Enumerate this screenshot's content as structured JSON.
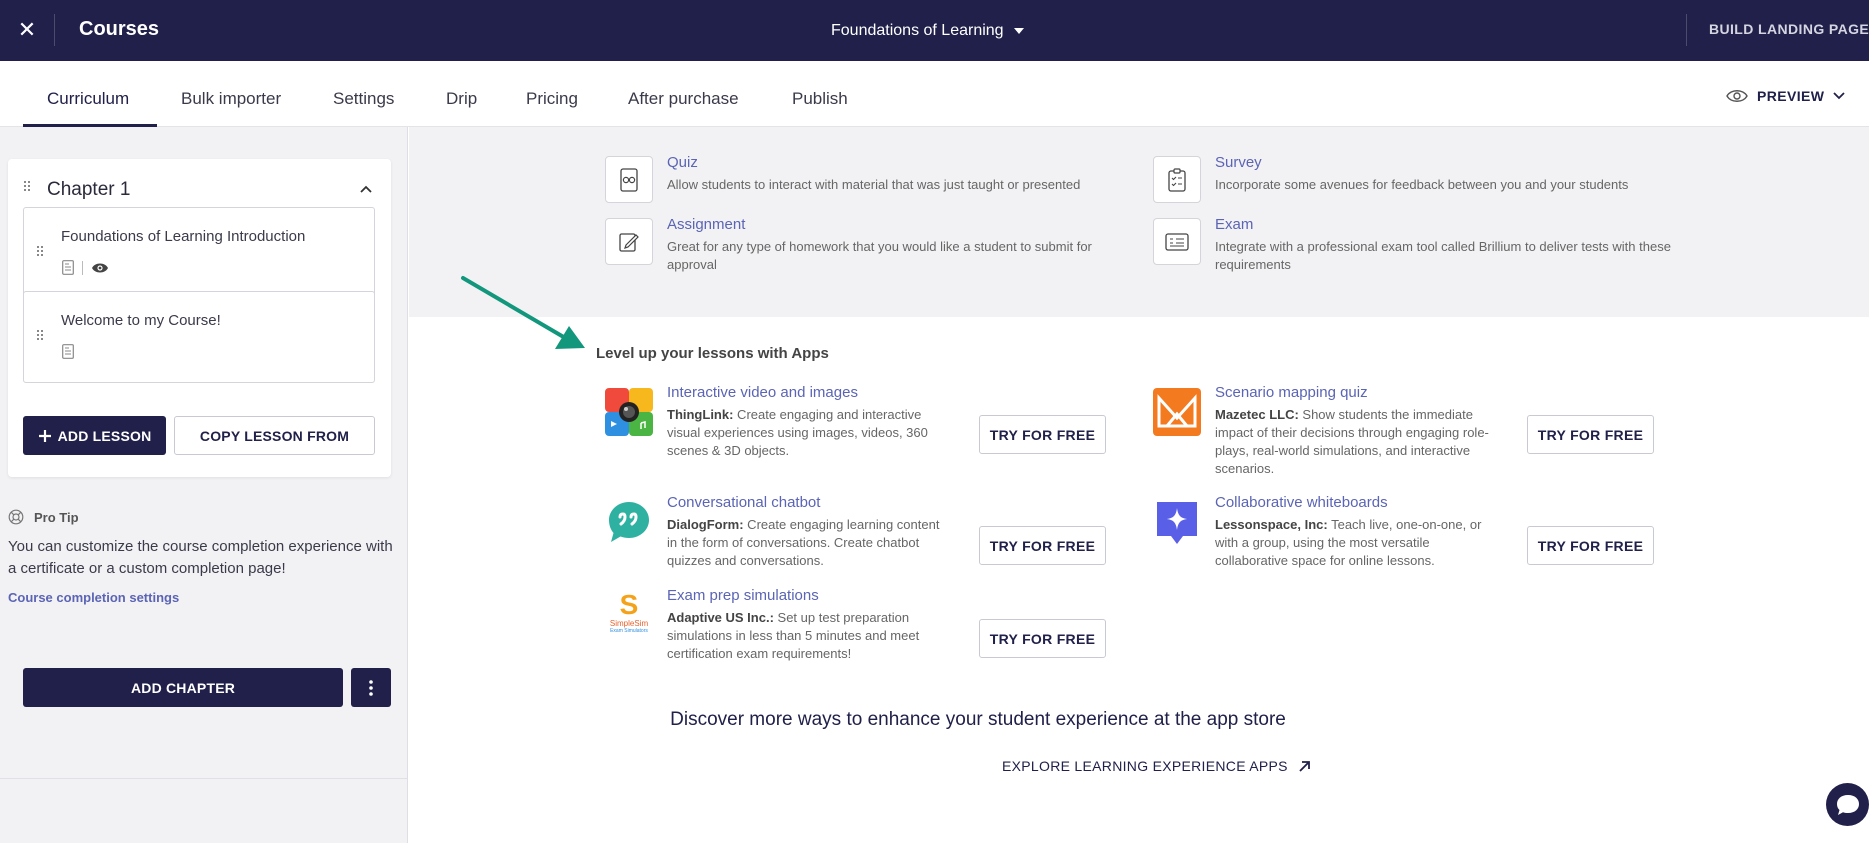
{
  "topbar": {
    "close_glyph": "✕",
    "title": "Courses",
    "course_name": "Foundations of Learning",
    "build_label": "BUILD LANDING PAGE →"
  },
  "tabs": [
    {
      "label": "Curriculum",
      "active": true
    },
    {
      "label": "Bulk importer"
    },
    {
      "label": "Settings"
    },
    {
      "label": "Drip"
    },
    {
      "label": "Pricing"
    },
    {
      "label": "After purchase"
    },
    {
      "label": "Publish"
    }
  ],
  "preview_label": "PREVIEW",
  "sidebar": {
    "chapter_title": "Chapter 1",
    "lessons": [
      {
        "title": "Foundations of Learning Introduction"
      },
      {
        "title": "Welcome to my Course!"
      }
    ],
    "add_lesson_label": "ADD LESSON",
    "copy_lesson_label": "COPY LESSON FROM",
    "protip_title": "Pro Tip",
    "protip_text": "You can customize the course completion experience with a certificate or a custom completion page!",
    "protip_link": "Course completion settings",
    "add_chapter_label": "ADD CHAPTER"
  },
  "types": [
    {
      "name": "Quiz",
      "desc": "Allow students to interact with material that was just taught or presented",
      "icon": "quiz-icon"
    },
    {
      "name": "Survey",
      "desc": "Incorporate some avenues for feedback between you and your students",
      "icon": "survey-icon"
    },
    {
      "name": "Assignment",
      "desc": "Great for any type of homework that you would like a student to submit for approval",
      "icon": "assignment-icon"
    },
    {
      "name": "Exam",
      "desc": "Integrate with a professional exam tool called Brillium to deliver tests with these requirements",
      "icon": "exam-icon"
    }
  ],
  "apps_heading": "Level up your lessons with Apps",
  "apps": [
    {
      "name": "Interactive video and images",
      "vendor": "ThingLink:",
      "desc": " Create engaging and interactive visual experiences using images, videos, 360 scenes & 3D objects.",
      "cta": "TRY FOR FREE"
    },
    {
      "name": "Scenario mapping quiz",
      "vendor": "Mazetec LLC:",
      "desc": " Show students the immediate impact of their decisions through engaging role-plays, real-world simulations, and interactive scenarios.",
      "cta": "TRY FOR FREE"
    },
    {
      "name": "Conversational chatbot",
      "vendor": "DialogForm:",
      "desc": " Create engaging learning content in the form of conversations. Create chatbot quizzes and conversations.",
      "cta": "TRY FOR FREE"
    },
    {
      "name": "Collaborative whiteboards",
      "vendor": "Lessonspace, Inc:",
      "desc": " Teach live, one-on-one, or with a group, using the most versatile collaborative space for online lessons.",
      "cta": "TRY FOR FREE"
    },
    {
      "name": "Exam prep simulations",
      "vendor": "Adaptive US Inc.:",
      "desc": " Set up test preparation simulations in less than 5 minutes and meet certification exam requirements!",
      "cta": "TRY FOR FREE"
    }
  ],
  "simplesim_logo_text": "SimpleSim",
  "simplesim_logo_sub": "Exam Simulators",
  "discover_text": "Discover more ways to enhance your student experience at the app store",
  "explore_label": "EXPLORE LEARNING EXPERIENCE APPS",
  "colors": {
    "nav": "#20204a",
    "link": "#5b64b5",
    "annotation_arrow": "#12977c"
  }
}
